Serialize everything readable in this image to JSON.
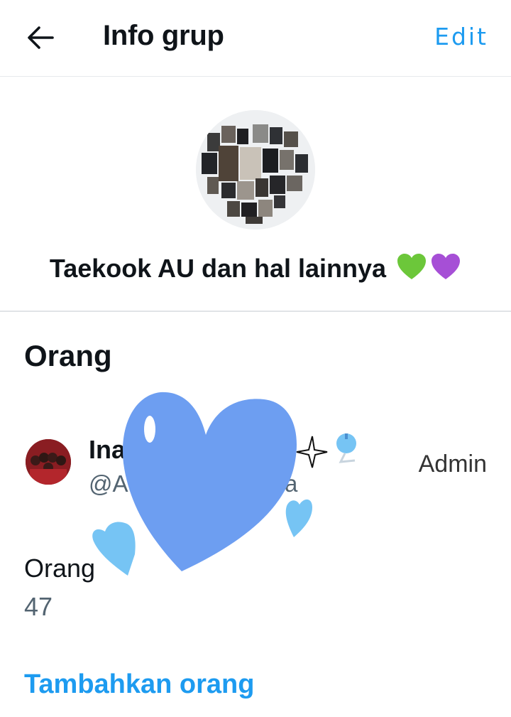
{
  "header": {
    "title": "Info grup",
    "edit_label": "Edit",
    "back_icon": "arrow-left-icon"
  },
  "group": {
    "name": "Taekook AU dan hal lainnya",
    "emojis": [
      "green-heart",
      "purple-heart"
    ],
    "avatar": "photo-collage"
  },
  "people_section": {
    "title": "Orang",
    "members": [
      {
        "name": "Ina",
        "handle": "@A",
        "handle_tail": "a",
        "role": "Admin"
      }
    ],
    "count_label": "Orang",
    "count": "47",
    "add_label": "Tambahkan orang"
  },
  "colors": {
    "accent": "#1d9bf0",
    "text": "#0f1419",
    "secondary": "#536471",
    "divider": "#e6e9ec",
    "redaction_blue": "#6d9ef1",
    "redaction_light_blue": "#76c4f4",
    "heart_green": "#6cc73a",
    "heart_purple": "#a64fd6"
  }
}
